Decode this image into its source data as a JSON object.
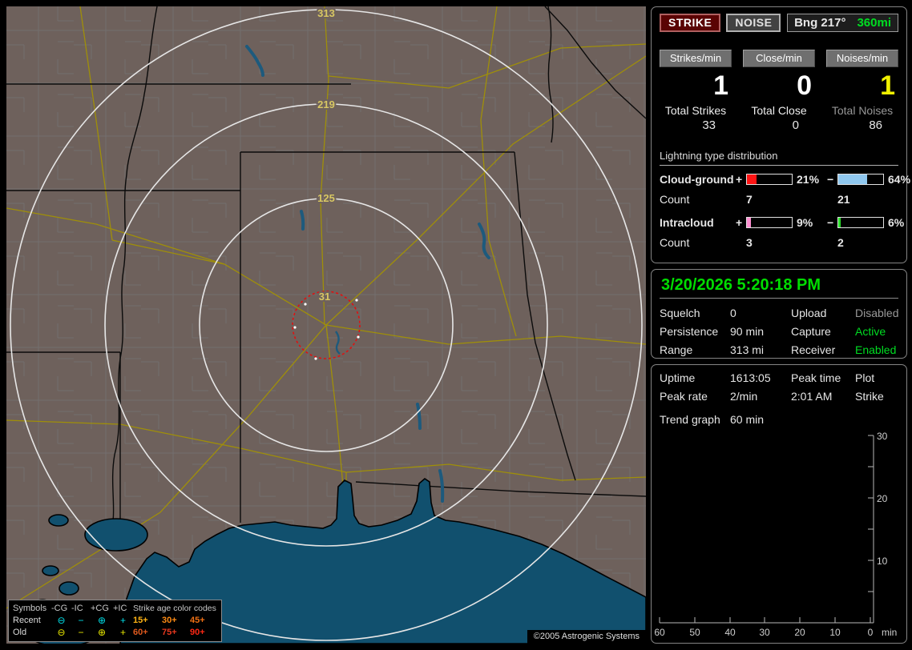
{
  "theme": {
    "land": "#6e615c",
    "water": "#11506e",
    "road": "#a59400",
    "county": "#7c8084",
    "ring": "#e6e6e6",
    "ring_label": "#d8c763",
    "alarm_ring": "#e01010",
    "accent_green": "#00dd22",
    "accent_yellow": "#f0f000",
    "panel_border": "#848484"
  },
  "toolbar": {
    "strike": "STRIKE",
    "noise": "NOISE",
    "bearing": "Bng 217°",
    "bearing_range": "360mi"
  },
  "rates": {
    "cols": [
      {
        "chip": "Strikes/min",
        "value": "1",
        "color": "#ffffff"
      },
      {
        "chip": "Close/min",
        "value": "0",
        "color": "#ffffff"
      },
      {
        "chip": "Noises/min",
        "value": "1",
        "color": "#f0f000"
      }
    ]
  },
  "totals": {
    "cols": [
      {
        "label": "Total Strikes",
        "value": "33",
        "label_color": "#eeeeee"
      },
      {
        "label": "Total Close",
        "value": "0",
        "label_color": "#eeeeee"
      },
      {
        "label": "Total Noises",
        "value": "86",
        "label_color": "#979797"
      }
    ]
  },
  "distribution": {
    "title": "Lightning type distribution",
    "rows": [
      {
        "name": "Cloud-ground",
        "plus": "+",
        "pos_pct": "21%",
        "pos_width": 21,
        "pos_color": "#ff1414",
        "minus": "−",
        "neg_pct": "64%",
        "neg_width": 64,
        "neg_color": "#8fc7ee",
        "count_label": "Count",
        "pos_count": "7",
        "neg_count": "21"
      },
      {
        "name": "Intracloud",
        "plus": "+",
        "pos_pct": "9%",
        "pos_width": 9,
        "pos_color": "#ff8fd2",
        "minus": "−",
        "neg_pct": "6%",
        "neg_width": 6,
        "neg_color": "#2ae02a",
        "count_label": "Count",
        "pos_count": "3",
        "neg_count": "2"
      }
    ]
  },
  "status": {
    "datetime": "3/20/2026 5:20:18 PM",
    "rows": [
      {
        "l1": "Squelch",
        "v1": "0",
        "l2": "Upload",
        "v2": "Disabled",
        "v2_color": "#999999"
      },
      {
        "l1": "Persistence",
        "v1": "90 min",
        "l2": "Capture",
        "v2": "Active",
        "v2_color": "#00dd22"
      },
      {
        "l1": "Range",
        "v1": "313 mi",
        "l2": "Receiver",
        "v2": "Enabled",
        "v2_color": "#00dd22"
      }
    ]
  },
  "stats": {
    "rows": [
      {
        "l1": "Uptime",
        "v1": "1613:05",
        "l2": "Peak time",
        "v2": "Plot"
      },
      {
        "l1": "Peak rate",
        "v1": "2/min",
        "l2": "2:01 AM",
        "v2": "Strike"
      }
    ],
    "trend_label": "Trend graph",
    "trend_value": "60 min"
  },
  "trend_graph": {
    "type": "line",
    "title": "Strike rate trend (strikes/min vs minutes ago)",
    "y_ticks": [
      "30",
      "20",
      "10"
    ],
    "y_range": [
      0,
      30
    ],
    "x_ticks": [
      "60",
      "50",
      "40",
      "30",
      "20",
      "10",
      "0"
    ],
    "x_unit": "min",
    "x_range": [
      60,
      0
    ],
    "series": []
  },
  "map": {
    "ring_labels": [
      "313",
      "219",
      "125",
      "31"
    ],
    "copyright": "©2005 Astrogenic Systems",
    "legend": {
      "header_symbols": "Symbols",
      "col_headers": [
        "-CG",
        "-IC",
        "+CG",
        "+IC"
      ],
      "age_header": "Strike age color codes",
      "rows": [
        {
          "label": "Recent",
          "color": "#00dfe8",
          "symbols": [
            "⊖",
            "−",
            "⊕",
            "+"
          ],
          "ages": [
            {
              "t": "15+",
              "c": "#ffb414"
            },
            {
              "t": "30+",
              "c": "#ff8c14"
            },
            {
              "t": "45+",
              "c": "#f07014"
            }
          ]
        },
        {
          "label": "Old",
          "color": "#e8e800",
          "symbols": [
            "⊖",
            "−",
            "⊕",
            "+"
          ],
          "ages": [
            {
              "t": "60+",
              "c": "#e05a1e"
            },
            {
              "t": "75+",
              "c": "#e8381e"
            },
            {
              "t": "90+",
              "c": "#ff2814"
            }
          ]
        }
      ]
    }
  }
}
